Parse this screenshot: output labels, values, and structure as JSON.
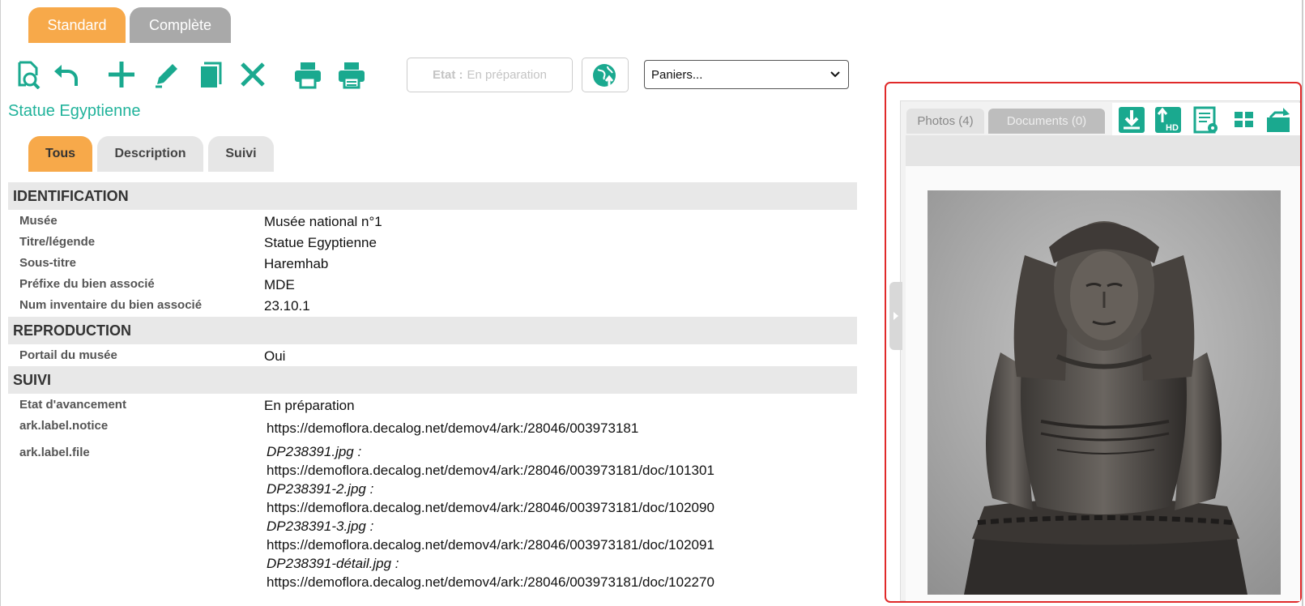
{
  "view_tabs": [
    {
      "label": "Standard",
      "active": true
    },
    {
      "label": "Complète",
      "active": false
    }
  ],
  "toolbar": {
    "icons": [
      "preview-icon",
      "undo-icon",
      "add-icon",
      "edit-icon",
      "copy-icon",
      "delete-icon",
      "print-icon",
      "print-list-icon"
    ],
    "etat_label": "Etat :",
    "etat_value": "En préparation",
    "paniers_selected": "Paniers..."
  },
  "record_title": "Statue Egyptienne",
  "sub_tabs": [
    {
      "label": "Tous",
      "active": true
    },
    {
      "label": "Description",
      "active": false
    },
    {
      "label": "Suivi",
      "active": false
    }
  ],
  "sections": {
    "identification": {
      "title": "IDENTIFICATION",
      "fields": [
        {
          "label": "Musée",
          "value": "Musée national n°1"
        },
        {
          "label": "Titre/légende",
          "value": "Statue Egyptienne"
        },
        {
          "label": "Sous-titre",
          "value": "Haremhab"
        },
        {
          "label": "Préfixe du bien associé",
          "value": "MDE"
        },
        {
          "label": "Num inventaire du bien associé",
          "value": "23.10.1"
        }
      ]
    },
    "reproduction": {
      "title": "REPRODUCTION",
      "fields": [
        {
          "label": "Portail du musée",
          "value": "Oui"
        }
      ]
    },
    "suivi": {
      "title": "SUIVI",
      "fields": [
        {
          "label": "Etat d'avancement",
          "value": "En préparation"
        },
        {
          "label": "ark.label.notice",
          "value": "https://demoflora.decalog.net/demov4/ark:/28046/003973181"
        },
        {
          "label": "ark.label.file",
          "value": ""
        }
      ],
      "files": [
        {
          "name": "DP238391.jpg :",
          "url": "https://demoflora.decalog.net/demov4/ark:/28046/003973181/doc/101301"
        },
        {
          "name": "DP238391-2.jpg :",
          "url": "https://demoflora.decalog.net/demov4/ark:/28046/003973181/doc/102090"
        },
        {
          "name": "DP238391-3.jpg :",
          "url": "https://demoflora.decalog.net/demov4/ark:/28046/003973181/doc/102091"
        },
        {
          "name": "DP238391-détail.jpg :",
          "url": "https://demoflora.decalog.net/demov4/ark:/28046/003973181/doc/102270"
        }
      ]
    }
  },
  "media_panel": {
    "tabs": [
      {
        "label": "Photos (4)",
        "active": true
      },
      {
        "label": "Documents (0)",
        "active": false
      }
    ],
    "icons": [
      "download-icon",
      "download-hd-icon",
      "details-icon",
      "grid-view-icon",
      "add-to-basket-icon"
    ]
  },
  "colors": {
    "accent_orange": "#f7a94a",
    "teal": "#1aa98f",
    "panel_border": "#e02a2a"
  }
}
